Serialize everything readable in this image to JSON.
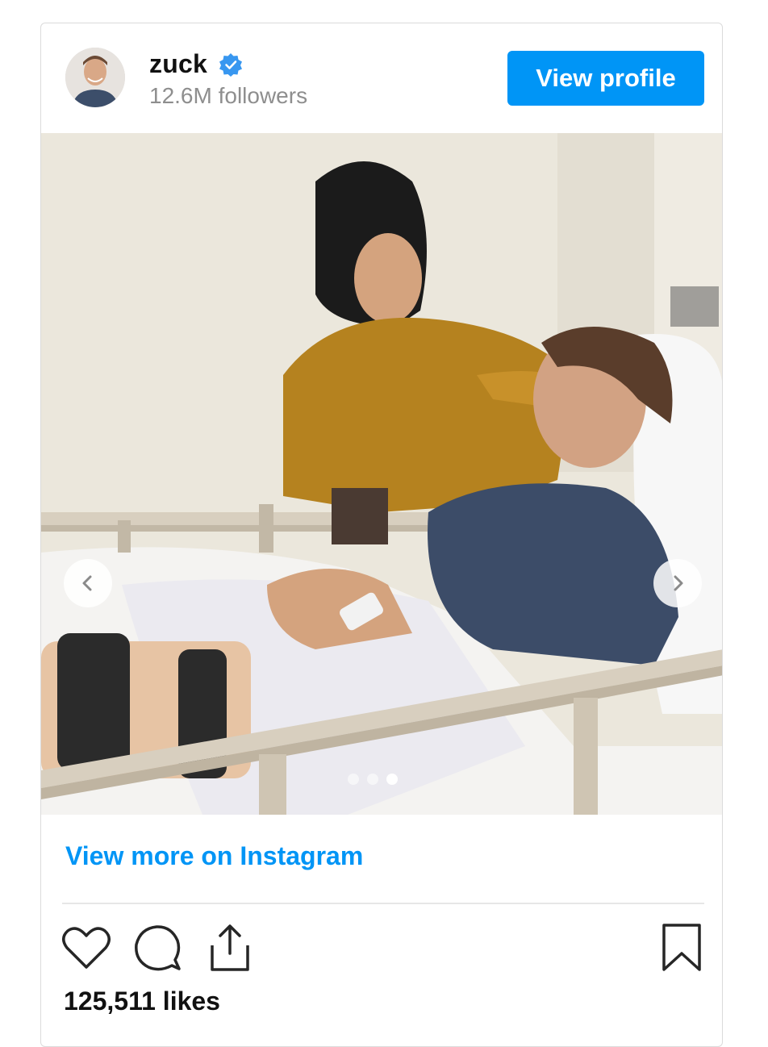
{
  "post": {
    "username": "zuck",
    "verified": true,
    "followers": "12.6M followers",
    "view_profile_label": "View profile",
    "view_more_label": "View more on Instagram",
    "likes": "125,511 likes"
  },
  "carousel": {
    "slide_count": 3,
    "active_slide": 3
  },
  "colors": {
    "accent": "#0095f6",
    "text": "#111111",
    "muted": "#8e8e8e",
    "border": "#dbdbdb"
  },
  "icons": {
    "like": "heart-icon",
    "comment": "comment-icon",
    "share": "share-icon",
    "save": "bookmark-icon",
    "verified": "verified-badge-icon",
    "prev": "chevron-left-icon",
    "next": "chevron-right-icon"
  }
}
